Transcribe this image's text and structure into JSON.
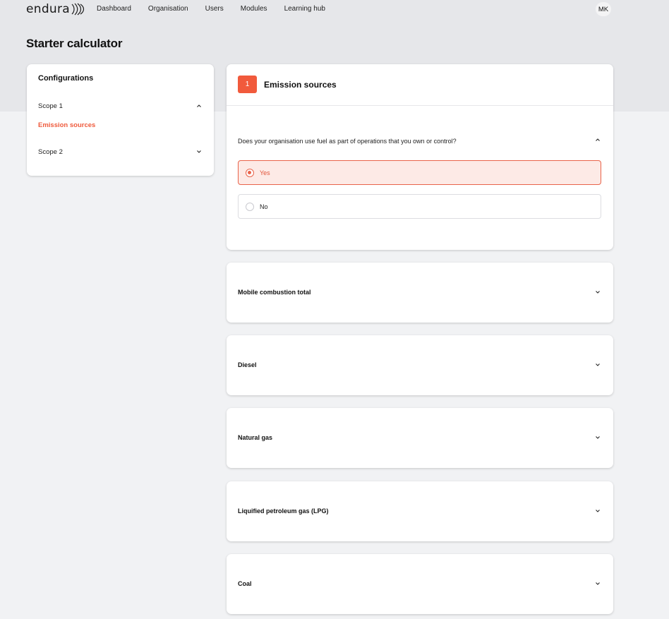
{
  "brand": {
    "name": "endura",
    "accent": "#f15a3c"
  },
  "nav": {
    "links": [
      "Dashboard",
      "Organisation",
      "Users",
      "Modules",
      "Learning hub"
    ],
    "avatar_initials": "MK"
  },
  "page": {
    "title": "Starter calculator"
  },
  "sidebar": {
    "title": "Configurations",
    "items": [
      {
        "label": "Scope 1",
        "icon": "chevron-up-icon"
      },
      {
        "label": "Emission sources",
        "active": true
      },
      {
        "label": "Scope 2",
        "icon": "chevron-down-icon"
      }
    ]
  },
  "main": {
    "step_number": "1",
    "section_title": "Emission sources",
    "question": "Does your organisation use fuel as part of operations that you own or control?",
    "options": [
      {
        "label": "Yes",
        "selected": true
      },
      {
        "label": "No",
        "selected": false
      }
    ]
  },
  "accordions": [
    {
      "label": "Mobile combustion total"
    },
    {
      "label": "Diesel"
    },
    {
      "label": "Natural gas"
    },
    {
      "label": "Liquified petroleum gas (LPG)"
    },
    {
      "label": "Coal"
    }
  ]
}
